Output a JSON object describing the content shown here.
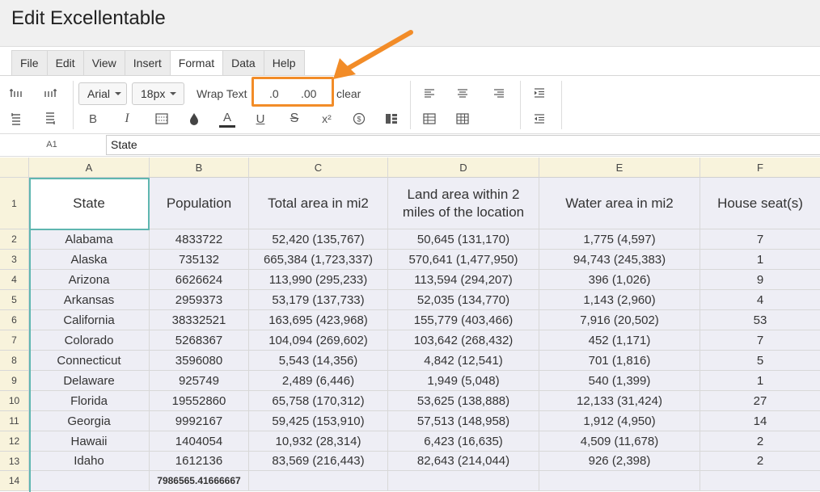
{
  "app": {
    "title": "Edit Excellentable"
  },
  "menu": {
    "items": [
      {
        "name": "menu-file",
        "label": "File"
      },
      {
        "name": "menu-edit",
        "label": "Edit"
      },
      {
        "name": "menu-view",
        "label": "View"
      },
      {
        "name": "menu-insert",
        "label": "Insert"
      },
      {
        "name": "menu-format",
        "label": "Format",
        "active": true
      },
      {
        "name": "menu-data",
        "label": "Data"
      },
      {
        "name": "menu-help",
        "label": "Help"
      }
    ]
  },
  "toolbar": {
    "font_family": "Arial",
    "font_size": "18px",
    "wrap_text": "Wrap Text",
    "decrease_decimal": ".0",
    "increase_decimal": ".00",
    "clear": "clear",
    "bold": "B",
    "italic": "I",
    "text_color": "A",
    "underline": "U",
    "strikethrough": "S",
    "superscript": "x²",
    "highlight_color": "#f28c28"
  },
  "formula_bar": {
    "cell_ref": "A1",
    "value": "State"
  },
  "grid": {
    "columns": [
      "A",
      "B",
      "C",
      "D",
      "E",
      "F"
    ],
    "rows": [
      "1",
      "2",
      "3",
      "4",
      "5",
      "6",
      "7",
      "8",
      "9",
      "10",
      "11",
      "12",
      "13",
      "14"
    ],
    "header": [
      "State",
      "Population",
      "Total area in mi2",
      "Land area within 2 miles of the location",
      "Water area in mi2",
      "House seat(s)"
    ],
    "data": [
      [
        "Alabama",
        "4833722",
        "52,420 (135,767)",
        "50,645 (131,170)",
        "1,775 (4,597)",
        "7"
      ],
      [
        "Alaska",
        "735132",
        "665,384 (1,723,337)",
        "570,641 (1,477,950)",
        "94,743 (245,383)",
        "1"
      ],
      [
        "Arizona",
        "6626624",
        "113,990 (295,233)",
        "113,594 (294,207)",
        "396 (1,026)",
        "9"
      ],
      [
        "Arkansas",
        "2959373",
        "53,179 (137,733)",
        "52,035 (134,770)",
        "1,143 (2,960)",
        "4"
      ],
      [
        "California",
        "38332521",
        "163,695 (423,968)",
        "155,779 (403,466)",
        "7,916 (20,502)",
        "53"
      ],
      [
        "Colorado",
        "5268367",
        "104,094 (269,602)",
        "103,642 (268,432)",
        "452 (1,171)",
        "7"
      ],
      [
        "Connecticut",
        "3596080",
        "5,543 (14,356)",
        "4,842 (12,541)",
        "701 (1,816)",
        "5"
      ],
      [
        "Delaware",
        "925749",
        "2,489 (6,446)",
        "1,949 (5,048)",
        "540 (1,399)",
        "1"
      ],
      [
        "Florida",
        "19552860",
        "65,758 (170,312)",
        "53,625 (138,888)",
        "12,133 (31,424)",
        "27"
      ],
      [
        "Georgia",
        "9992167",
        "59,425 (153,910)",
        "57,513 (148,958)",
        "1,912 (4,950)",
        "14"
      ],
      [
        "Hawaii",
        "1404054",
        "10,932 (28,314)",
        "6,423 (16,635)",
        "4,509 (11,678)",
        "2"
      ],
      [
        "Idaho",
        "1612136",
        "83,569 (216,443)",
        "82,643 (214,044)",
        "926 (2,398)",
        "2"
      ],
      [
        "",
        "7986565.41666667",
        "",
        "",
        "",
        ""
      ]
    ]
  }
}
